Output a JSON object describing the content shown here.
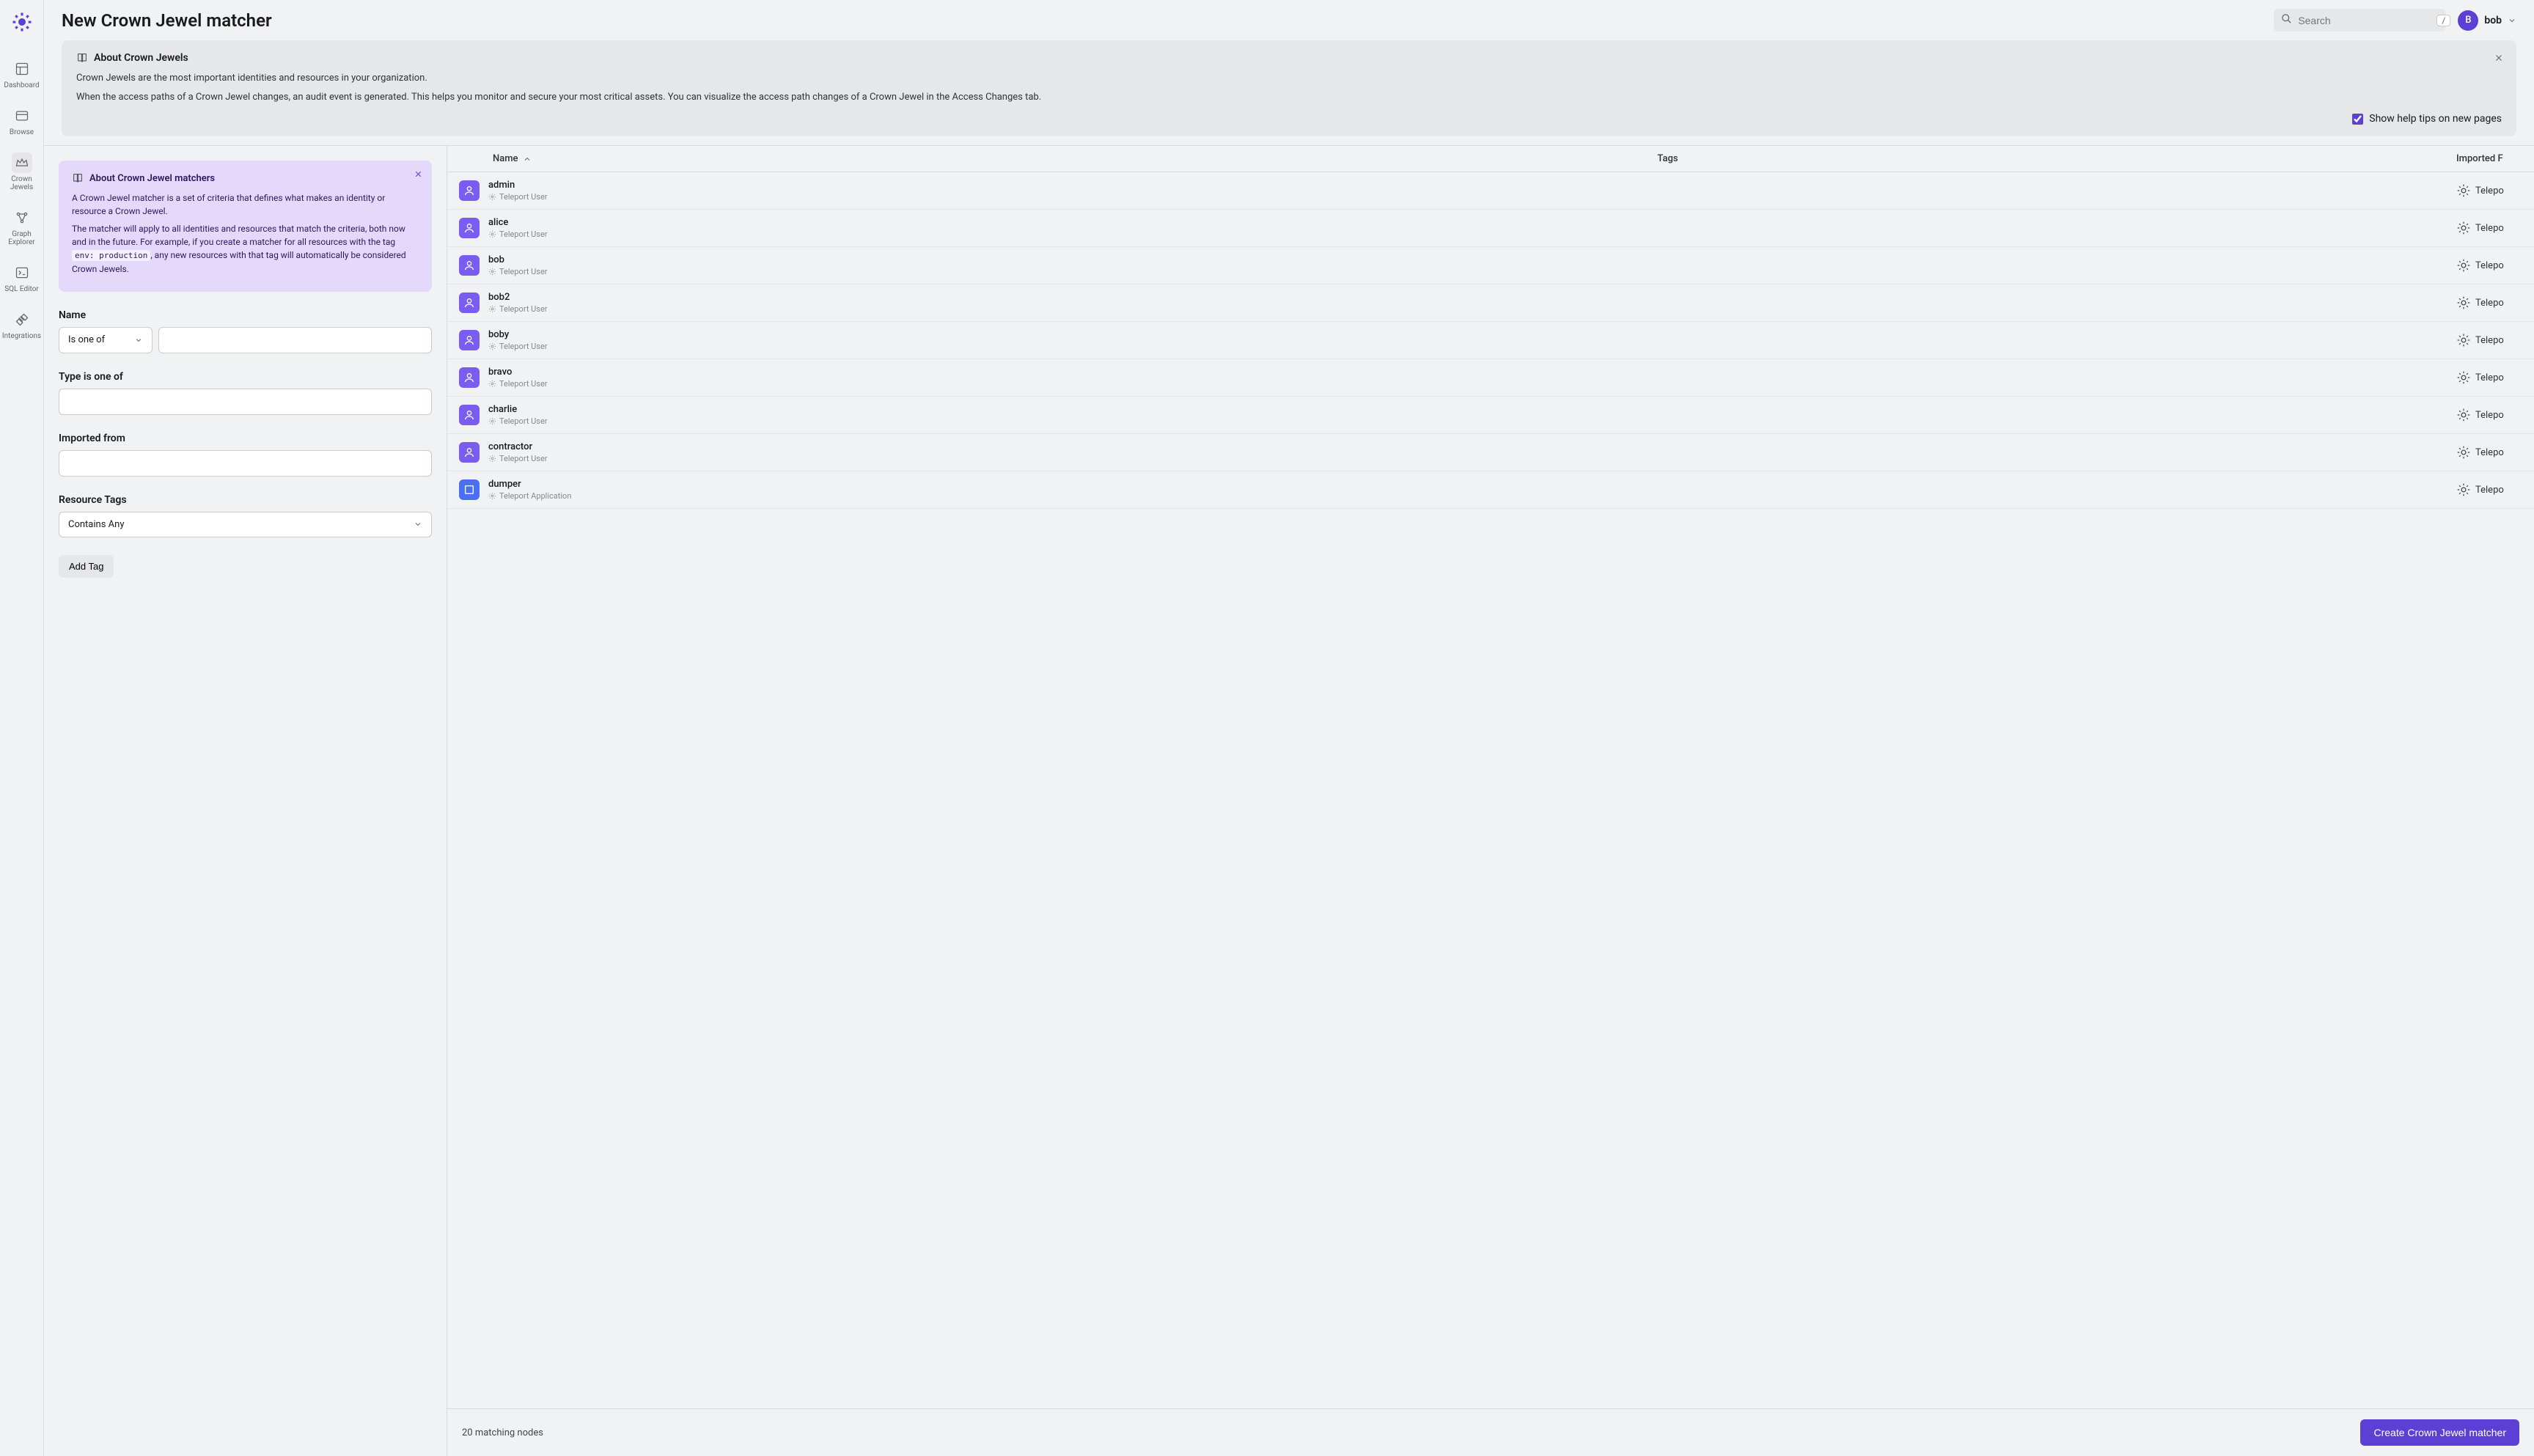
{
  "page": {
    "title": "New Crown Jewel matcher"
  },
  "search": {
    "placeholder": "Search",
    "shortcut": "/"
  },
  "user": {
    "name": "bob",
    "initial": "B"
  },
  "sidebar": {
    "items": [
      {
        "label": "Dashboard",
        "icon": "dashboard"
      },
      {
        "label": "Browse",
        "icon": "browse"
      },
      {
        "label": "Crown Jewels",
        "icon": "crown",
        "active": true
      },
      {
        "label": "Graph Explorer",
        "icon": "graph"
      },
      {
        "label": "SQL Editor",
        "icon": "sql"
      },
      {
        "label": "Integrations",
        "icon": "integrations"
      }
    ]
  },
  "banner": {
    "title": "About Crown Jewels",
    "p1": "Crown Jewels are the most important identities and resources in your organization.",
    "p2": "When the access paths of a Crown Jewel changes, an audit event is generated. This helps you monitor and secure your most critical assets. You can visualize the access path changes of a Crown Jewel in the Access Changes tab.",
    "checkbox_label": "Show help tips on new pages"
  },
  "purple": {
    "title": "About Crown Jewel matchers",
    "p1": "A Crown Jewel matcher is a set of criteria that defines what makes an identity or resource a Crown Jewel.",
    "p2a": "The matcher will apply to all identities and resources that match the criteria, both now and in the future. For example, if you create a matcher for all resources with the tag ",
    "code": "env: production",
    "p2b": ", any new resources with that tag will automatically be considered Crown Jewels."
  },
  "form": {
    "name_label": "Name",
    "name_operator": "Is one of",
    "type_label": "Type is one of",
    "imported_label": "Imported from",
    "tags_label": "Resource Tags",
    "tags_operator": "Contains Any",
    "add_tag": "Add Tag"
  },
  "table": {
    "columns": {
      "name": "Name",
      "tags": "Tags",
      "imported": "Imported F"
    },
    "rows": [
      {
        "name": "admin",
        "sub": "Teleport User",
        "kind": "user",
        "imported": "Telepo"
      },
      {
        "name": "alice",
        "sub": "Teleport User",
        "kind": "user",
        "imported": "Telepo"
      },
      {
        "name": "bob",
        "sub": "Teleport User",
        "kind": "user",
        "imported": "Telepo"
      },
      {
        "name": "bob2",
        "sub": "Teleport User",
        "kind": "user",
        "imported": "Telepo"
      },
      {
        "name": "boby",
        "sub": "Teleport User",
        "kind": "user",
        "imported": "Telepo"
      },
      {
        "name": "bravo",
        "sub": "Teleport User",
        "kind": "user",
        "imported": "Telepo"
      },
      {
        "name": "charlie",
        "sub": "Teleport User",
        "kind": "user",
        "imported": "Telepo"
      },
      {
        "name": "contractor",
        "sub": "Teleport User",
        "kind": "user",
        "imported": "Telepo"
      },
      {
        "name": "dumper",
        "sub": "Teleport Application",
        "kind": "app",
        "imported": "Telepo"
      }
    ]
  },
  "footer": {
    "count": "20 matching nodes",
    "button": "Create Crown Jewel matcher"
  }
}
